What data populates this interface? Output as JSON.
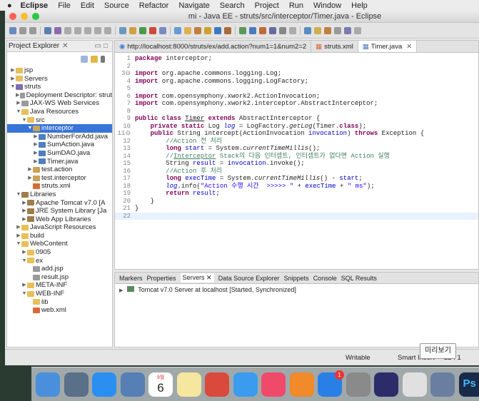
{
  "menubar": {
    "apple": "",
    "app": "Eclipse",
    "items": [
      "File",
      "Edit",
      "Source",
      "Refactor",
      "Navigate",
      "Search",
      "Project",
      "Run",
      "Window",
      "Help"
    ]
  },
  "window": {
    "title": "mi - Java EE - struts/src/interceptor/Timer.java - Eclipse"
  },
  "explorer": {
    "title": "Project Explorer",
    "close": "✕",
    "tree": [
      {
        "label": "jsp",
        "depth": 0,
        "arrow": "▶",
        "icon": "fold"
      },
      {
        "label": "Servers",
        "depth": 0,
        "arrow": "▶",
        "icon": "fold"
      },
      {
        "label": "struts",
        "depth": 0,
        "arrow": "▼",
        "icon": "proj"
      },
      {
        "label": "Deployment Descriptor: strut",
        "depth": 1,
        "arrow": "▶",
        "icon": "jsp"
      },
      {
        "label": "JAX-WS Web Services",
        "depth": 1,
        "arrow": "▶",
        "icon": "jsp"
      },
      {
        "label": "Java Resources",
        "depth": 1,
        "arrow": "▼",
        "icon": "fold"
      },
      {
        "label": "src",
        "depth": 2,
        "arrow": "▼",
        "icon": "fold"
      },
      {
        "label": "interceptor",
        "depth": 3,
        "arrow": "▼",
        "icon": "pkg",
        "selected": true
      },
      {
        "label": "NumberForAdd.java",
        "depth": 4,
        "arrow": "▶",
        "icon": "java"
      },
      {
        "label": "SumAction.java",
        "depth": 4,
        "arrow": "▶",
        "icon": "java"
      },
      {
        "label": "SumDAO.java",
        "depth": 4,
        "arrow": "▶",
        "icon": "java"
      },
      {
        "label": "Timer.java",
        "depth": 4,
        "arrow": "▶",
        "icon": "java"
      },
      {
        "label": "test.action",
        "depth": 3,
        "arrow": "▶",
        "icon": "pkg"
      },
      {
        "label": "test.interceptor",
        "depth": 3,
        "arrow": "▶",
        "icon": "pkg"
      },
      {
        "label": "struts.xml",
        "depth": 3,
        "arrow": "",
        "icon": "xml"
      },
      {
        "label": "Libraries",
        "depth": 1,
        "arrow": "▼",
        "icon": "lib"
      },
      {
        "label": "Apache Tomcat v7.0 [A",
        "depth": 2,
        "arrow": "▶",
        "icon": "lib"
      },
      {
        "label": "JRE System Library [Ja",
        "depth": 2,
        "arrow": "▶",
        "icon": "lib"
      },
      {
        "label": "Web App Libraries",
        "depth": 2,
        "arrow": "▶",
        "icon": "lib"
      },
      {
        "label": "JavaScript Resources",
        "depth": 1,
        "arrow": "▶",
        "icon": "fold"
      },
      {
        "label": "build",
        "depth": 1,
        "arrow": "▶",
        "icon": "fold"
      },
      {
        "label": "WebContent",
        "depth": 1,
        "arrow": "▼",
        "icon": "fold"
      },
      {
        "label": "0905",
        "depth": 2,
        "arrow": "▶",
        "icon": "fold"
      },
      {
        "label": "ex",
        "depth": 2,
        "arrow": "▼",
        "icon": "fold"
      },
      {
        "label": "add.jsp",
        "depth": 3,
        "arrow": "",
        "icon": "jsp"
      },
      {
        "label": "result.jsp",
        "depth": 3,
        "arrow": "",
        "icon": "jsp"
      },
      {
        "label": "META-INF",
        "depth": 2,
        "arrow": "▶",
        "icon": "fold"
      },
      {
        "label": "WEB-INF",
        "depth": 2,
        "arrow": "▼",
        "icon": "fold"
      },
      {
        "label": "lib",
        "depth": 3,
        "arrow": "",
        "icon": "fold"
      },
      {
        "label": "web.xml",
        "depth": 3,
        "arrow": "",
        "icon": "xml"
      }
    ]
  },
  "editor": {
    "tabs": [
      {
        "label": "http://localhost:8000/struts/ex/add.action?num1=1&num2=2",
        "active": false
      },
      {
        "label": "struts.xml",
        "active": false
      },
      {
        "label": "Timer.java",
        "active": true
      }
    ],
    "lines": [
      {
        "n": "1",
        "html": "<span class='kw'>package</span> interceptor;"
      },
      {
        "n": "2",
        "html": ""
      },
      {
        "n": "3⊖",
        "html": "<span class='kw'>import</span> org.apache.commons.logging.Log;"
      },
      {
        "n": "4",
        "html": "<span class='kw'>import</span> org.apache.commons.logging.LogFactory;"
      },
      {
        "n": "5",
        "html": ""
      },
      {
        "n": "6",
        "html": "<span class='kw'>import</span> com.opensymphony.xwork2.ActionInvocation;"
      },
      {
        "n": "7",
        "html": "<span class='kw'>import</span> com.opensymphony.xwork2.interceptor.AbstractInterceptor;"
      },
      {
        "n": "8",
        "html": ""
      },
      {
        "n": "9",
        "html": "<span class='kw'>public class</span> <u>Timer</u> <span class='kw'>extends</span> AbstractInterceptor {"
      },
      {
        "n": "10",
        "html": "    <span class='kw'>private static</span> Log <span class='fd it'>log</span> = LogFactory.<span class='it'>getLog</span>(Timer.<span class='kw'>class</span>);"
      },
      {
        "n": "11⊖",
        "html": "    <span class='kw'>public</span> String intercept(ActionInvocation <span class='fd'>invocation</span>) <span class='kw'>throws</span> Exception {"
      },
      {
        "n": "12",
        "html": "        <span class='cm'>//Action 전 처리</span>"
      },
      {
        "n": "13",
        "html": "        <span class='kw'>long</span> <span class='fd'>start</span> = System.<span class='it'>currentTimeMillis</span>();"
      },
      {
        "n": "14",
        "html": "        <span class='cm'>//<u>Interceptor</u> Stack의 다음 인터셉트, 인터셉트가 없다면 Action 실행</span>"
      },
      {
        "n": "15",
        "html": "        String <span class='fd'>result</span> = <span class='fd'>invocation</span>.invoke();"
      },
      {
        "n": "16",
        "html": "        <span class='cm'>//Action 후 처리</span>"
      },
      {
        "n": "17",
        "html": "        <span class='kw'>long</span> <span class='fd'>execTime</span> = System.<span class='it'>currentTimeMillis</span>() - <span class='fd'>start</span>;"
      },
      {
        "n": "18",
        "html": "        <span class='fd it'>log</span>.info(<span class='st'>\"Action 수행 시간  >>>>> \"</span> + <span class='fd'>execTime</span> + <span class='st'>\" ms\"</span>);"
      },
      {
        "n": "19",
        "html": "        <span class='kw'>return</span> <span class='fd'>result</span>;"
      },
      {
        "n": "20",
        "html": "    }"
      },
      {
        "n": "21",
        "html": "}"
      },
      {
        "n": "22",
        "html": ""
      }
    ]
  },
  "bottom": {
    "tabs": [
      "Markers",
      "Properties",
      "Servers ✕",
      "Data Source Explorer",
      "Snippets",
      "Console",
      "SQL Results"
    ],
    "server": "Tomcat v7.0 Server at localhost  [Started, Synchronized]"
  },
  "status": {
    "writable": "Writable",
    "insert": "Smart Insert",
    "pos": "22 : 1"
  },
  "tooltip": "미리보기",
  "dock": {
    "calendar_month": "9월",
    "calendar_day": "6",
    "appstore_badge": "1",
    "ps": "Ps",
    "icons": [
      "finder-icon",
      "launchpad-icon",
      "safari-icon",
      "preview-icon",
      "calendar-icon",
      "notes-icon",
      "photo-booth-icon",
      "messages-icon",
      "music-icon",
      "books-icon",
      "app-store-icon",
      "system-preferences-icon",
      "eclipse-icon",
      "chrome-icon",
      "photos-icon",
      "photoshop-icon"
    ],
    "colors": [
      "#4a8fdc",
      "#5a6f88",
      "#2a8ff0",
      "#557fb5",
      "#ffffff",
      "#f5e6a0",
      "#d94a3c",
      "#3a9bef",
      "#f04a6b",
      "#f08a2a",
      "#2a7fe6",
      "#8a8a8a",
      "#2c2c6a",
      "#e0e0e0",
      "#6a7fa0",
      "#1a2a4a"
    ]
  }
}
